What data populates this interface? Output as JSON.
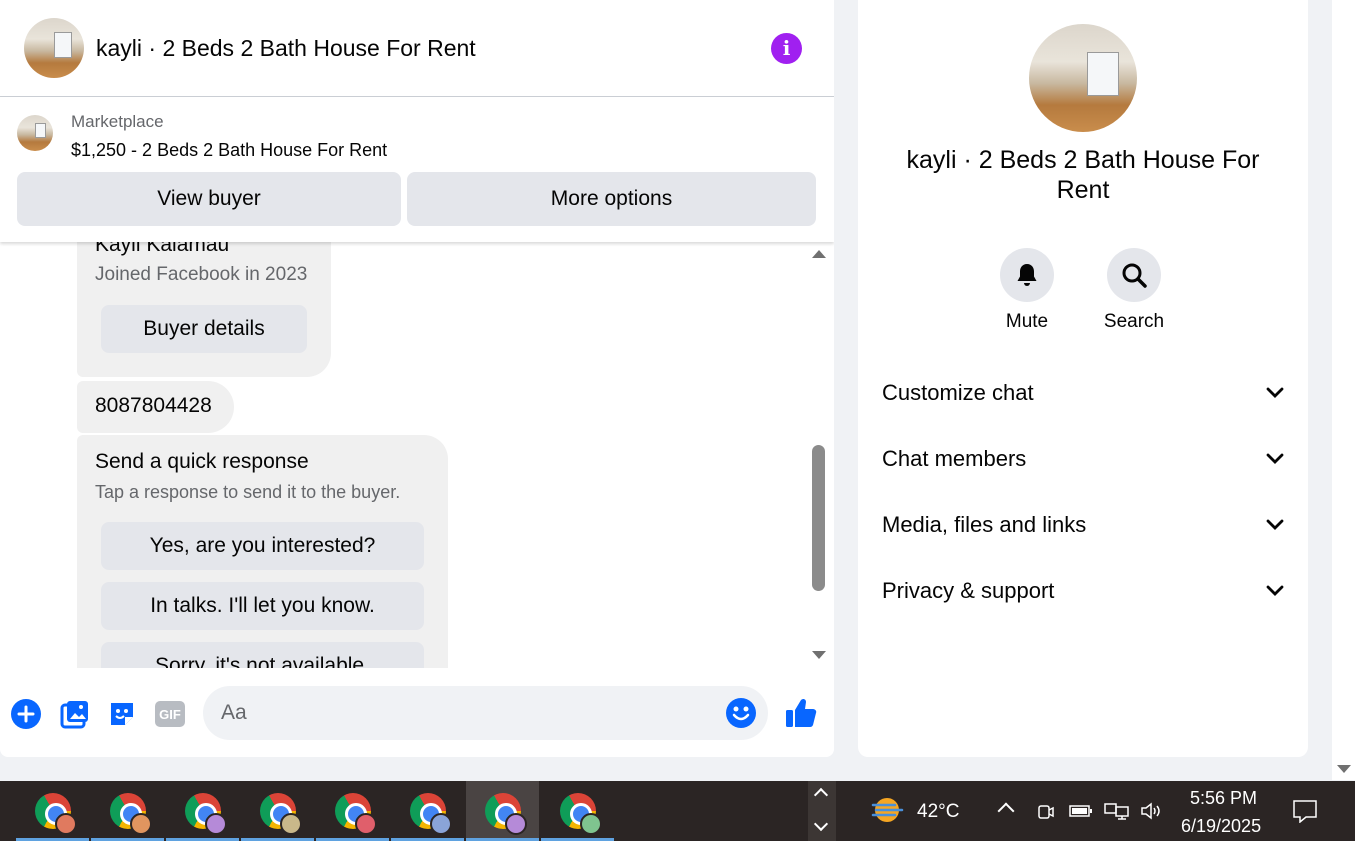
{
  "chat": {
    "title": "kayli · 2 Beds 2 Bath House For Rent",
    "marketplace_label": "Marketplace",
    "listing": "$1,250 - 2 Beds 2 Bath House For Rent",
    "view_buyer": "View buyer",
    "more_options": "More options"
  },
  "messages": {
    "buyer_name": "Kayli Kalamau",
    "joined": "Joined Facebook in 2023",
    "buyer_details": "Buyer details",
    "phone": "8087804428",
    "quick_title": "Send a quick response",
    "quick_sub": "Tap a response to send it to the buyer.",
    "responses": [
      "Yes, are you interested?",
      "In talks. I'll let you know.",
      "Sorry, it's not available."
    ]
  },
  "composer": {
    "placeholder": "Aa",
    "gif_label": "GIF"
  },
  "side": {
    "title": "kayli · 2 Beds 2 Bath House For Rent",
    "mute": "Mute",
    "search": "Search",
    "sections": [
      "Customize chat",
      "Chat members",
      "Media, files and links",
      "Privacy & support"
    ]
  },
  "taskbar": {
    "temp": "42°C",
    "time": "5:56 PM",
    "date": "6/19/2025",
    "apps": [
      {
        "name": "chrome-profile-1",
        "profile_color": "#e07a5f"
      },
      {
        "name": "chrome-profile-2",
        "profile_color": "#e0955f"
      },
      {
        "name": "chrome-profile-3",
        "profile_color": "#b58ad8"
      },
      {
        "name": "chrome-profile-4",
        "profile_color": "#c9b88a"
      },
      {
        "name": "chrome-profile-5",
        "profile_color": "#e05f6b"
      },
      {
        "name": "chrome-profile-6",
        "profile_color": "#8aa4d8"
      },
      {
        "name": "chrome-profile-7",
        "profile_color": "#b58ad8"
      },
      {
        "name": "chrome-profile-8",
        "profile_color": "#7fc48f"
      }
    ]
  },
  "colors": {
    "accent": "#0866ff",
    "info": "#a020f0"
  }
}
